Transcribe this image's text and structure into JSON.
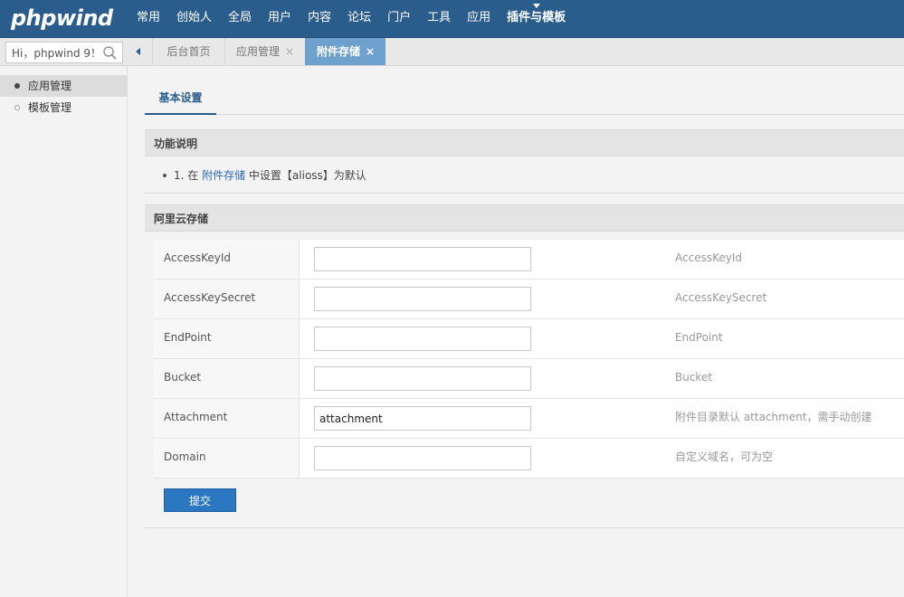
{
  "brand": {
    "logo_text": "phpwind"
  },
  "nav": {
    "items": [
      {
        "label": "常用"
      },
      {
        "label": "创始人"
      },
      {
        "label": "全局"
      },
      {
        "label": "用户"
      },
      {
        "label": "内容"
      },
      {
        "label": "论坛"
      },
      {
        "label": "门户"
      },
      {
        "label": "工具"
      },
      {
        "label": "应用"
      },
      {
        "label": "插件与模板"
      }
    ],
    "active_index": 9
  },
  "search": {
    "value": "Hi，phpwind 9！",
    "icon": "search-icon"
  },
  "tabs": [
    {
      "label": "后台首页",
      "closable": false
    },
    {
      "label": "应用管理",
      "closable": true
    },
    {
      "label": "附件存储",
      "closable": true
    }
  ],
  "tab_close_glyph": "×",
  "sidebar": {
    "items": [
      {
        "label": "应用管理",
        "active": true
      },
      {
        "label": "模板管理",
        "active": false
      }
    ]
  },
  "page_tabs": [
    {
      "label": "基本设置"
    }
  ],
  "sections": {
    "description": {
      "title": "功能说明",
      "line_prefix": "1. 在 ",
      "line_link": "附件存储",
      "line_suffix": " 中设置【alioss】为默认"
    },
    "aliyun": {
      "title": "阿里云存储"
    }
  },
  "form": {
    "rows": [
      {
        "label": "AccessKeyId",
        "value": "",
        "tip": "AccessKeyId"
      },
      {
        "label": "AccessKeySecret",
        "value": "",
        "tip": "AccessKeySecret"
      },
      {
        "label": "EndPoint",
        "value": "",
        "tip": "EndPoint"
      },
      {
        "label": "Bucket",
        "value": "",
        "tip": "Bucket"
      },
      {
        "label": "Attachment",
        "value": "attachment",
        "tip": "附件目录默认 attachment，需手动创建"
      },
      {
        "label": "Domain",
        "value": "",
        "tip": "自定义域名，可为空"
      }
    ],
    "submit_label": "提交"
  },
  "colors": {
    "topbar": "#2a5d8c",
    "active_tab": "#6ea1cd",
    "link": "#2a6bb5",
    "button": "#2c77c2"
  }
}
